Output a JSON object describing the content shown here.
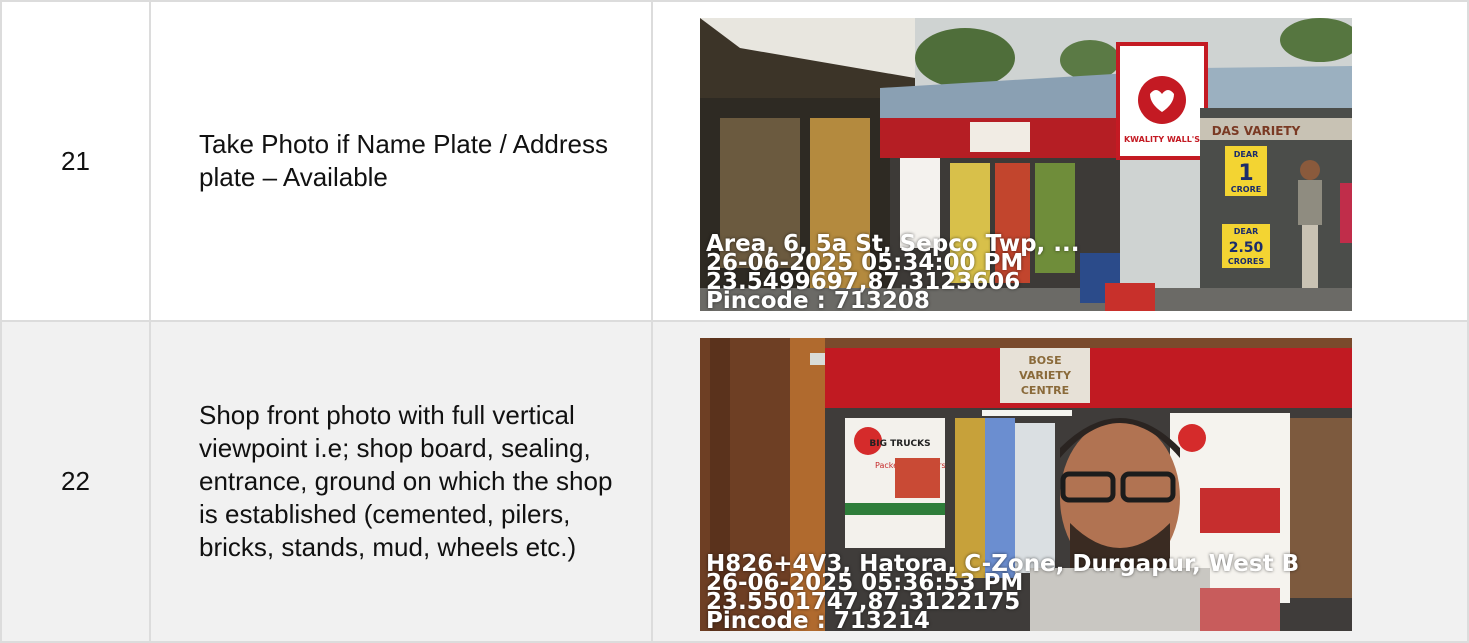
{
  "rows": [
    {
      "number": "21",
      "description": "Take Photo if Name Plate / Address plate – Available",
      "photo": {
        "sign_text": "DAS VARIETY",
        "board_text": "KWALITY WALL'S",
        "ticket_1_label": "DEAR",
        "ticket_1_value": "1",
        "ticket_1_unit": "CRORE",
        "ticket_2_label": "DEAR",
        "ticket_2_value": "2.50",
        "ticket_2_unit": "CRORES",
        "stamp": {
          "address": "Area, 6, 5a St, Sepco Twp, ...",
          "datetime": "26-06-2025 05:34:00 PM",
          "coords": "23.5499697,87.3123606",
          "pincode": "Pincode : 713208"
        }
      }
    },
    {
      "number": "22",
      "description": "Shop front photo with full vertical viewpoint i.e; shop board, sealing, entrance, ground on which the shop is established (cemented, pilers, bricks, stands, mud, wheels etc.)",
      "photo": {
        "banner_text": "BOSE VARIETY CENTRE",
        "poster_text": "BIG TRUCKS",
        "poster_sub": "Packers & Movers",
        "stamp": {
          "address": "H826+4V3, Hatora, C-Zone, Durgapur, West B",
          "datetime": "26-06-2025 05:36:53 PM",
          "coords": "23.5501747,87.3122175",
          "pincode": "Pincode : 713214"
        }
      }
    }
  ]
}
